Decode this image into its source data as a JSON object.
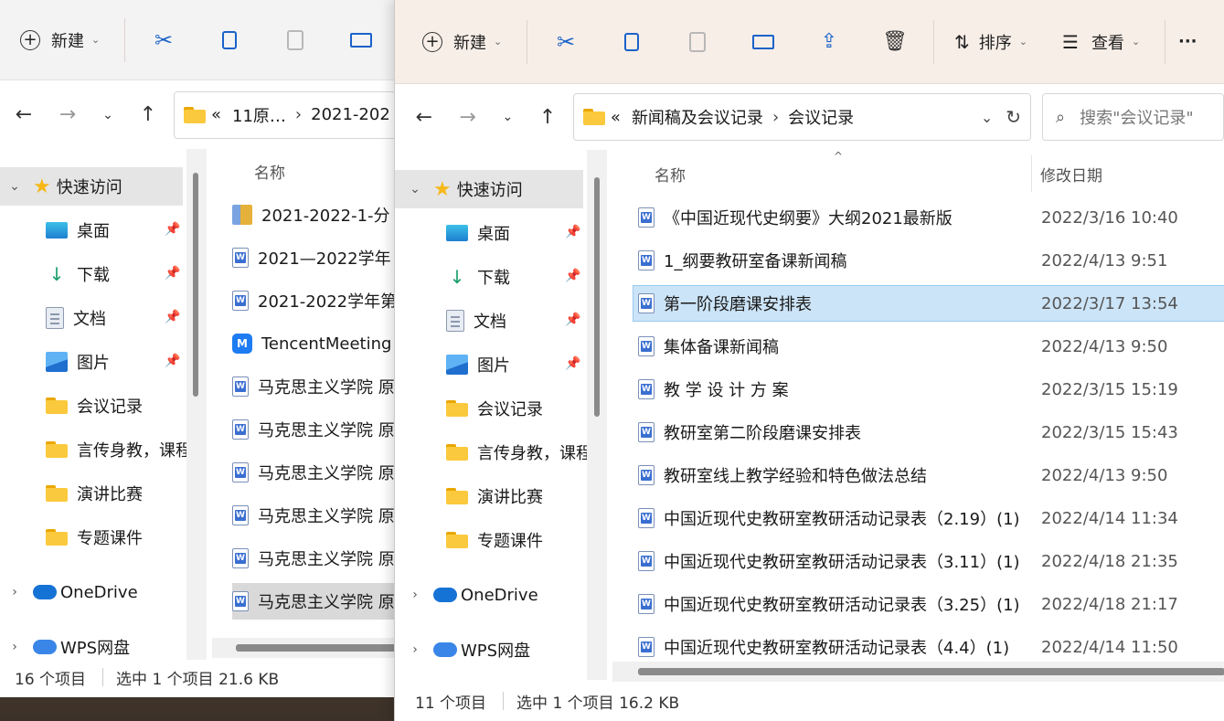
{
  "back_window": {
    "toolbar": {
      "new_label": "新建"
    },
    "address": {
      "crumbs": [
        "«",
        "11原…",
        "›",
        "2021-202"
      ]
    },
    "nav": {
      "quick_access": "快速访问",
      "items": [
        {
          "label": "桌面",
          "pinned": true
        },
        {
          "label": "下载",
          "pinned": true
        },
        {
          "label": "文档",
          "pinned": true
        },
        {
          "label": "图片",
          "pinned": true
        },
        {
          "label": "会议记录",
          "pinned": false
        },
        {
          "label": "言传身教，课程",
          "pinned": false
        },
        {
          "label": "演讲比赛",
          "pinned": false
        },
        {
          "label": "专题课件",
          "pinned": false
        }
      ],
      "onedrive": "OneDrive",
      "wps": "WPS网盘"
    },
    "list": {
      "col_name": "名称",
      "rows": [
        {
          "name": "2021-2022-1-分"
        },
        {
          "name": "2021—2022学年"
        },
        {
          "name": "2021-2022学年第"
        },
        {
          "name": "TencentMeeting"
        },
        {
          "name": "马克思主义学院 原"
        },
        {
          "name": "马克思主义学院 原"
        },
        {
          "name": "马克思主义学院 原"
        },
        {
          "name": "马克思主义学院 原"
        },
        {
          "name": "马克思主义学院 原"
        },
        {
          "name": "马克思主义学院 原"
        }
      ]
    },
    "status": {
      "count": "16 个项目",
      "selection": "选中 1 个项目  21.6 KB"
    }
  },
  "front_window": {
    "toolbar": {
      "new_label": "新建",
      "sort_label": "排序",
      "view_label": "查看",
      "more_label": "···"
    },
    "address": {
      "crumbs": [
        "«",
        "新闻稿及会议记录",
        "›",
        "会议记录"
      ],
      "search_placeholder": "搜索\"会议记录\""
    },
    "nav": {
      "quick_access": "快速访问",
      "items": [
        {
          "label": "桌面",
          "pinned": true
        },
        {
          "label": "下载",
          "pinned": true
        },
        {
          "label": "文档",
          "pinned": true
        },
        {
          "label": "图片",
          "pinned": true
        },
        {
          "label": "会议记录",
          "pinned": false
        },
        {
          "label": "言传身教，课程",
          "pinned": false
        },
        {
          "label": "演讲比赛",
          "pinned": false
        },
        {
          "label": "专题课件",
          "pinned": false
        }
      ],
      "onedrive": "OneDrive",
      "wps": "WPS网盘"
    },
    "list": {
      "col_name": "名称",
      "col_date": "修改日期",
      "rows": [
        {
          "name": "《中国近现代史纲要》大纲2021最新版",
          "date": "2022/3/16 10:40"
        },
        {
          "name": "1_纲要教研室备课新闻稿",
          "date": "2022/4/13 9:51"
        },
        {
          "name": "第一阶段磨课安排表",
          "date": "2022/3/17 13:54"
        },
        {
          "name": "集体备课新闻稿",
          "date": "2022/4/13 9:50"
        },
        {
          "name": "教 学 设 计 方 案",
          "date": "2022/3/15 15:19"
        },
        {
          "name": "教研室第二阶段磨课安排表",
          "date": "2022/3/15 15:43"
        },
        {
          "name": "教研室线上教学经验和特色做法总结",
          "date": "2022/4/13 9:50"
        },
        {
          "name": "中国近现代史教研室教研活动记录表（2.19）(1)",
          "date": "2022/4/14 11:34"
        },
        {
          "name": "中国近现代史教研室教研活动记录表（3.11）(1)",
          "date": "2022/4/18 21:35"
        },
        {
          "name": "中国近现代史教研室教研活动记录表（3.25）(1)",
          "date": "2022/4/18 21:17"
        },
        {
          "name": "中国近现代史教研室教研活动记录表（4.4）(1)",
          "date": "2022/4/14 11:50"
        }
      ]
    },
    "status": {
      "count": "11 个项目",
      "selection": "选中 1 个项目  16.2 KB"
    }
  }
}
